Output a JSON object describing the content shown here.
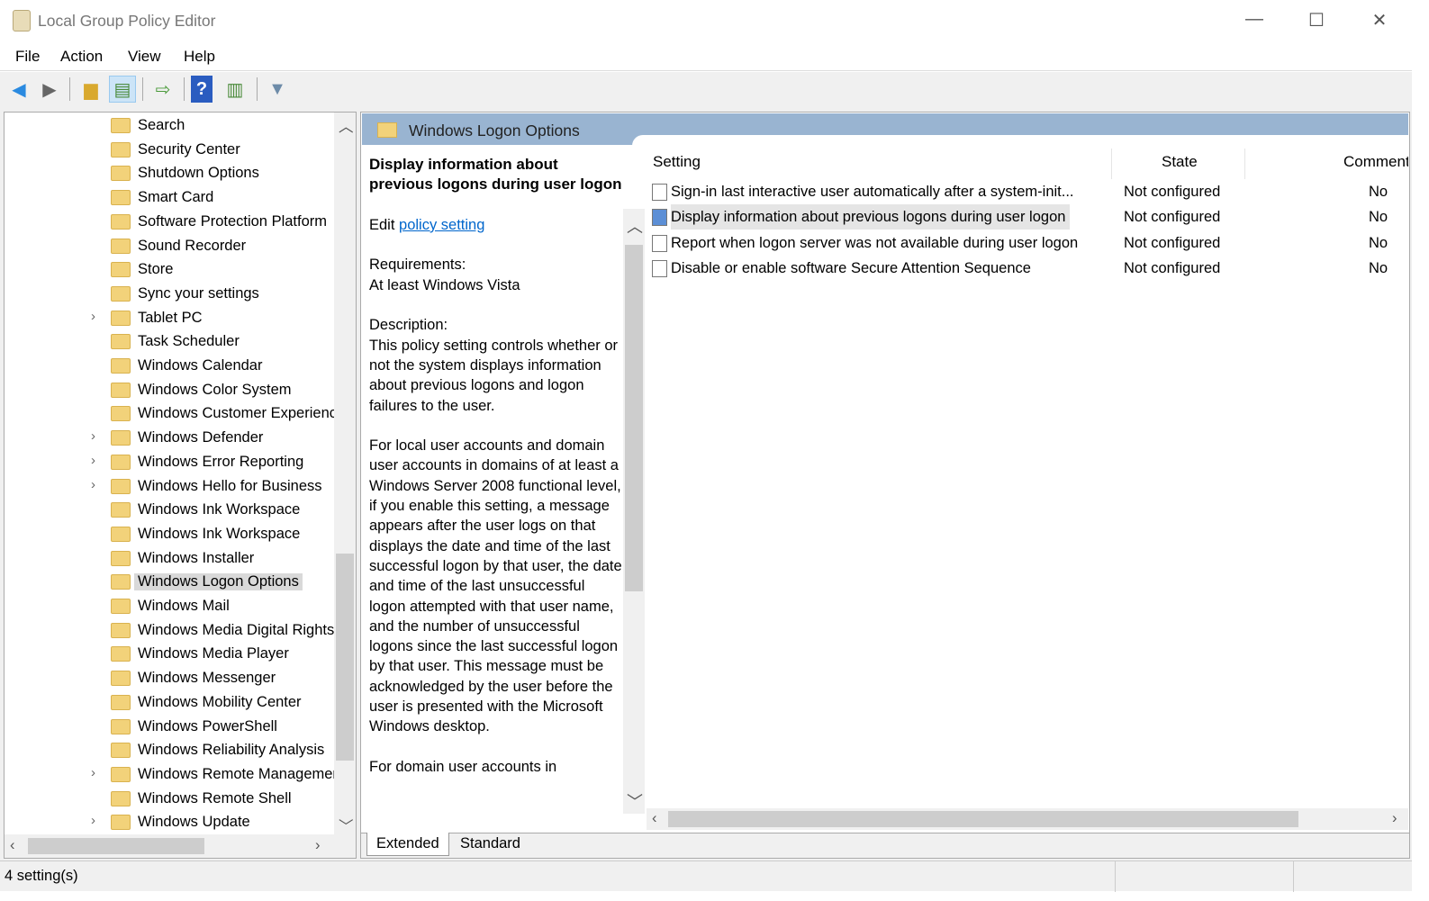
{
  "window": {
    "title": "Local Group Policy Editor",
    "minimize": "—",
    "maximize": "☐",
    "close": "✕"
  },
  "menu": [
    "File",
    "Action",
    "View",
    "Help"
  ],
  "toolbar": [
    "back-icon",
    "forward-icon",
    "up-folder-icon",
    "show-hide-tree-icon",
    "export-list-icon",
    "help-icon",
    "show-action-pane-icon",
    "filter-icon"
  ],
  "tree": {
    "items": [
      {
        "label": "Search",
        "expandable": false
      },
      {
        "label": "Security Center",
        "expandable": false
      },
      {
        "label": "Shutdown Options",
        "expandable": false
      },
      {
        "label": "Smart Card",
        "expandable": false
      },
      {
        "label": "Software Protection Platform",
        "expandable": false
      },
      {
        "label": "Sound Recorder",
        "expandable": false
      },
      {
        "label": "Store",
        "expandable": false
      },
      {
        "label": "Sync your settings",
        "expandable": false
      },
      {
        "label": "Tablet PC",
        "expandable": true
      },
      {
        "label": "Task Scheduler",
        "expandable": false
      },
      {
        "label": "Windows Calendar",
        "expandable": false
      },
      {
        "label": "Windows Color System",
        "expandable": false
      },
      {
        "label": "Windows Customer Experience",
        "expandable": false
      },
      {
        "label": "Windows Defender",
        "expandable": true
      },
      {
        "label": "Windows Error Reporting",
        "expandable": true
      },
      {
        "label": "Windows Hello for Business",
        "expandable": true
      },
      {
        "label": "Windows Ink Workspace",
        "expandable": false
      },
      {
        "label": "Windows Ink Workspace",
        "expandable": false
      },
      {
        "label": "Windows Installer",
        "expandable": false
      },
      {
        "label": "Windows Logon Options",
        "expandable": false,
        "selected": true
      },
      {
        "label": "Windows Mail",
        "expandable": false
      },
      {
        "label": "Windows Media Digital Rights",
        "expandable": false
      },
      {
        "label": "Windows Media Player",
        "expandable": false
      },
      {
        "label": "Windows Messenger",
        "expandable": false
      },
      {
        "label": "Windows Mobility Center",
        "expandable": false
      },
      {
        "label": "Windows PowerShell",
        "expandable": false
      },
      {
        "label": "Windows Reliability Analysis",
        "expandable": false
      },
      {
        "label": "Windows Remote Management",
        "expandable": true
      },
      {
        "label": "Windows Remote Shell",
        "expandable": false
      },
      {
        "label": "Windows Update",
        "expandable": true
      }
    ]
  },
  "pane": {
    "header": "Windows Logon Options",
    "desc": {
      "title": "Display information about previous logons during user logon",
      "edit": "Edit",
      "link": "policy setting",
      "requirements_label": "Requirements:",
      "requirements": "At least Windows Vista",
      "description_label": "Description:",
      "p1": "This policy setting controls whether or not the system displays information about previous logons and logon failures to the user.",
      "p2": "For local user accounts and domain user accounts in domains of at least a Windows Server 2008 functional level, if you enable this setting, a message appears after the user logs on that displays the date and time of the last successful logon by that user, the date and time of the last unsuccessful logon attempted with that user name, and the number of unsuccessful logons since the last successful logon by that user. This message must be acknowledged by the user before the user is presented with the Microsoft Windows desktop.",
      "p3": "For domain user accounts in"
    },
    "columns": [
      "Setting",
      "State",
      "Comment"
    ],
    "rows": [
      {
        "setting": "Sign-in last interactive user automatically after a system-init...",
        "state": "Not configured",
        "comment": "No"
      },
      {
        "setting": "Display information about previous logons during user logon",
        "state": "Not configured",
        "comment": "No",
        "selected": true
      },
      {
        "setting": "Report when logon server was not available during user logon",
        "state": "Not configured",
        "comment": "No"
      },
      {
        "setting": "Disable or enable software Secure Attention Sequence",
        "state": "Not configured",
        "comment": "No"
      }
    ],
    "tabs": [
      "Extended",
      "Standard"
    ]
  },
  "status": "4 setting(s)"
}
